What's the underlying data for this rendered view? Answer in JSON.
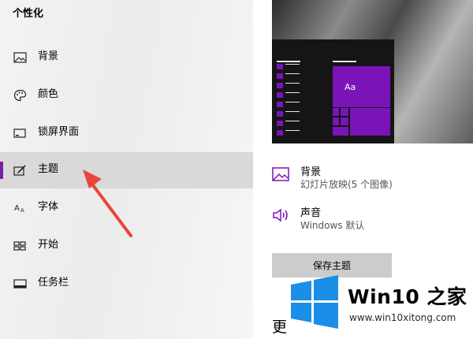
{
  "sidebar": {
    "title": "个性化",
    "items": [
      {
        "label": "背景",
        "icon": "picture-icon"
      },
      {
        "label": "颜色",
        "icon": "palette-icon"
      },
      {
        "label": "锁屏界面",
        "icon": "lock-screen-icon"
      },
      {
        "label": "主题",
        "icon": "theme-brush-icon",
        "selected": true
      },
      {
        "label": "字体",
        "icon": "font-icon"
      },
      {
        "label": "开始",
        "icon": "start-icon"
      },
      {
        "label": "任务栏",
        "icon": "taskbar-icon"
      }
    ]
  },
  "preview": {
    "tile_text": "Aa"
  },
  "theme_settings": {
    "background": {
      "title": "背景",
      "value": "幻灯片放映(5 个图像)",
      "icon": "picture-icon"
    },
    "sound": {
      "title": "声音",
      "value": "Windows 默认",
      "icon": "speaker-icon"
    },
    "save_label": "保存主题",
    "more_text": "更"
  },
  "watermark": {
    "title": "Win10 之家",
    "url": "www.win10xitong.com"
  },
  "colors": {
    "accent": "#7b14b8",
    "selected_bg": "#d9d9d9",
    "arrow": "#e8463b",
    "logo_blue": "#1b8ee8"
  }
}
